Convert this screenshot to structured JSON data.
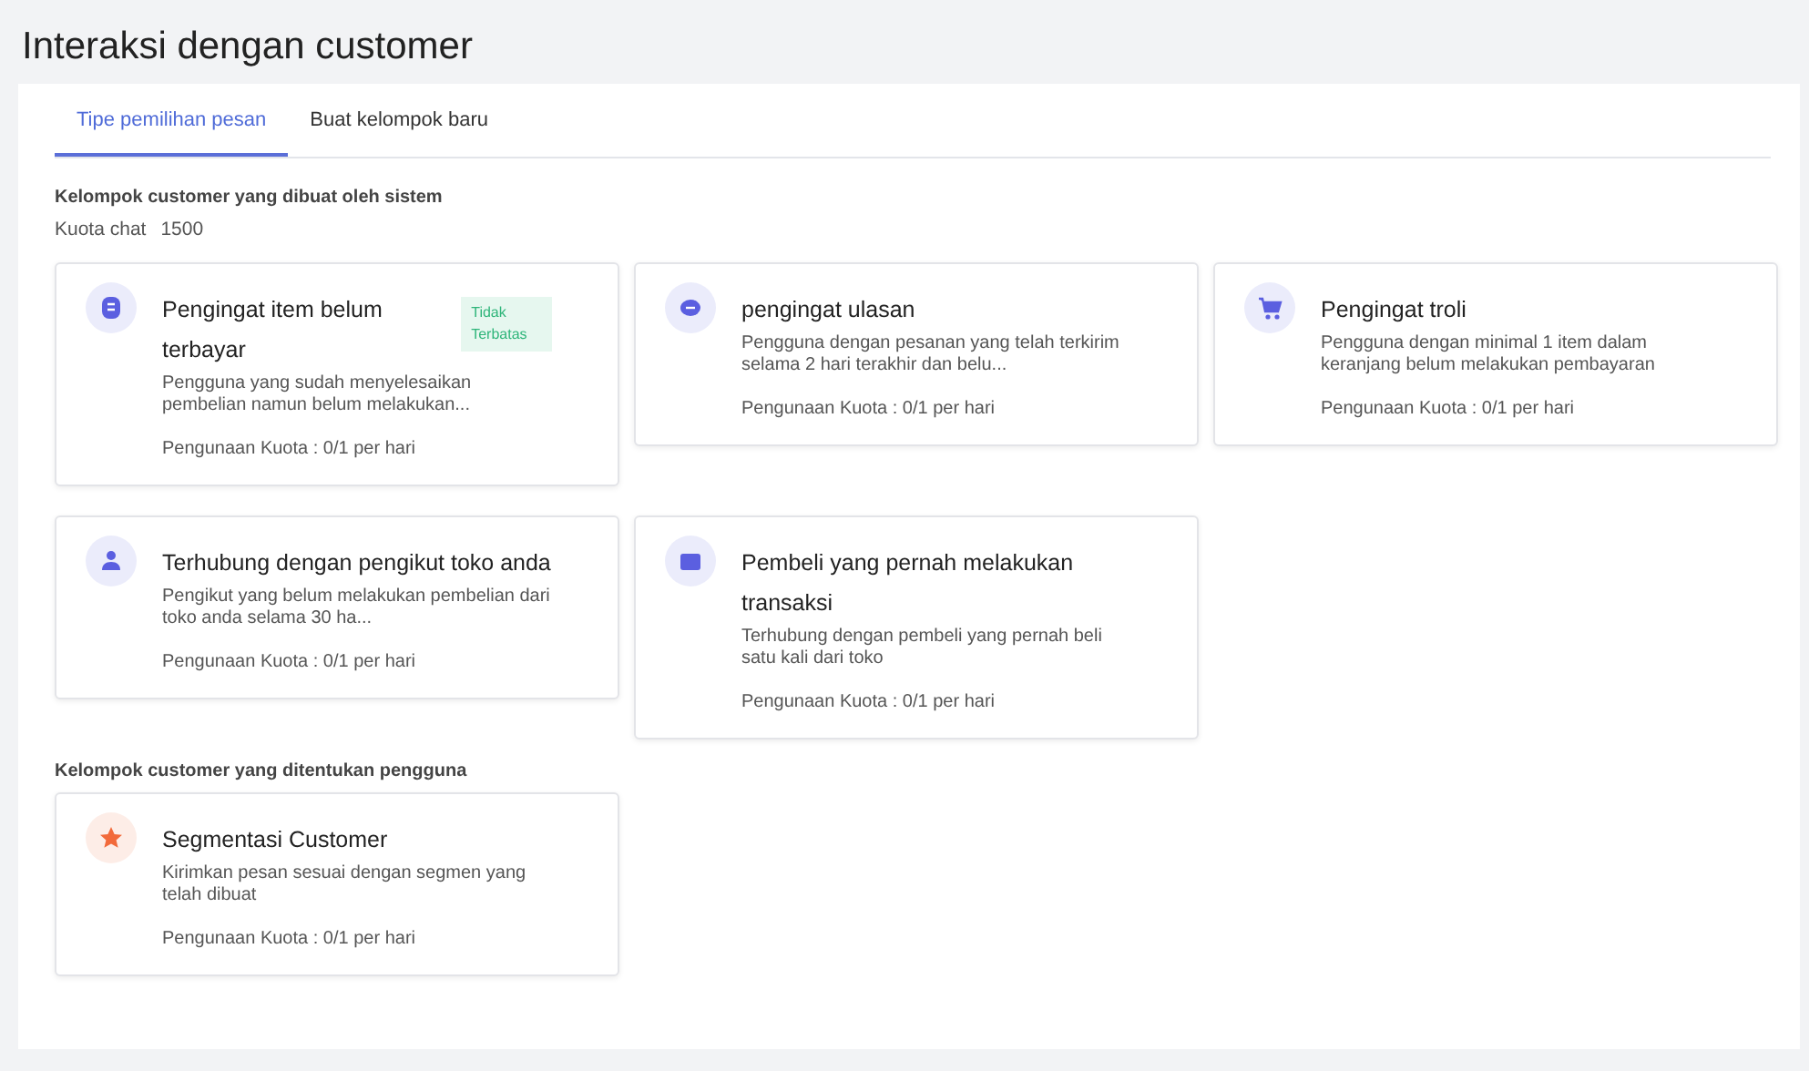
{
  "page_title": "Interaksi dengan customer",
  "tabs": [
    {
      "label": "Tipe pemilihan pesan",
      "selected": true
    },
    {
      "label": "Buat kelompok baru",
      "selected": false
    }
  ],
  "system_section": {
    "heading": "Kelompok customer yang dibuat oleh sistem",
    "quota_label": "Kuota chat",
    "quota_value": "1500",
    "cards": [
      {
        "kind": "chat",
        "color": "#5b5fe0",
        "title": "Pengingat item belum terbayar",
        "badge": "Tidak Terbatas",
        "description": "Pengguna yang sudah menyelesaikan pembelian namun belum melakukan...",
        "usage": "Pengunaan Kuota : 0/1 per hari"
      },
      {
        "kind": "comment",
        "color": "#5b5fe0",
        "title": "pengingat ulasan",
        "description": "Pengguna dengan pesanan yang telah terkirim selama 2 hari terakhir dan belu...",
        "usage": "Pengunaan Kuota : 0/1 per hari"
      },
      {
        "kind": "cart",
        "color": "#5b5fe0",
        "title": "Pengingat troli",
        "description": "Pengguna dengan minimal 1 item dalam keranjang belum melakukan pembayaran",
        "usage": "Pengunaan Kuota : 0/1 per hari"
      },
      {
        "kind": "person",
        "color": "#5b5fe0",
        "title": "Terhubung dengan pengikut toko anda",
        "description": "Pengikut yang belum melakukan pembelian dari toko anda selama 30 ha...",
        "usage": "Pengunaan Kuota : 0/1 per hari"
      },
      {
        "kind": "box",
        "color": "#5b5fe0",
        "title": "Pembeli yang pernah melakukan transaksi",
        "description": "Terhubung dengan pembeli yang pernah beli satu kali dari toko",
        "usage": "Pengunaan Kuota : 0/1 per hari"
      }
    ]
  },
  "user_section": {
    "heading": "Kelompok customer yang ditentukan pengguna",
    "cards": [
      {
        "kind": "star",
        "color": "#f26a3b",
        "title": "Segmentasi Customer",
        "description": "Kirimkan pesan sesuai dengan segmen yang telah dibuat",
        "usage": "Pengunaan Kuota : 0/1 per hari"
      }
    ]
  }
}
